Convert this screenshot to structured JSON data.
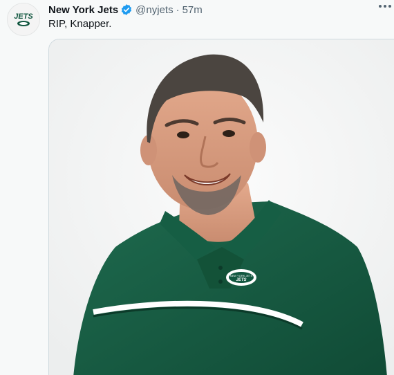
{
  "tweet": {
    "author": {
      "display_name": "New York Jets",
      "handle": "@nyjets",
      "verified": true,
      "avatar_icon": "jets-logo-icon",
      "avatar_text": "JETS"
    },
    "separator": "·",
    "time": "57m",
    "text": "RIP, Knapper.",
    "media": {
      "type": "photo",
      "shirt_logo_text": "NEW YORK JETS"
    }
  },
  "colors": {
    "jets_green": "#125740",
    "verified_blue": "#1d9bf0",
    "muted_text": "#536471"
  }
}
